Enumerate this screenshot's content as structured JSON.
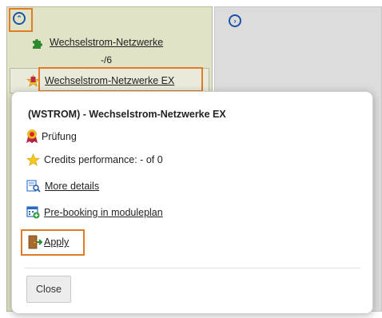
{
  "tree": {
    "collapse_glyph": "⌃",
    "expand_glyph": "›",
    "parent_node": {
      "label": "Wechselstrom-Netzwerke",
      "credits": "-/6",
      "icon": "puzzle-icon"
    },
    "child_node": {
      "label": "Wechselstrom-Netzwerke EX",
      "icon": "star-badge-icon"
    }
  },
  "popup": {
    "title": "(WSTROM) - Wechselstrom-Netzwerke EX",
    "rows": [
      {
        "icon": "exam-badge-icon",
        "label": "Prüfung"
      },
      {
        "icon": "star-icon",
        "label": "Credits performance: - of 0"
      },
      {
        "icon": "magnifier-doc-icon",
        "label": "More details"
      },
      {
        "icon": "calendar-add-icon",
        "label": "Pre-booking in moduleplan"
      },
      {
        "icon": "door-exit-icon",
        "label": "Apply"
      }
    ],
    "close_label": "Close"
  },
  "colors": {
    "accent": "#1b54a6",
    "highlight": "#e07b26",
    "panel": "#e2e2c6"
  }
}
